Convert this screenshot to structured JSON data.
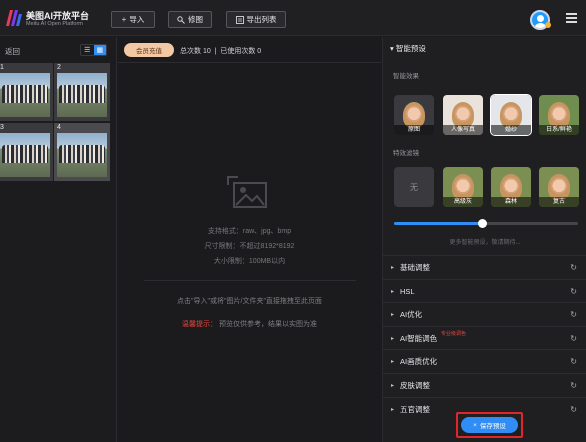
{
  "app": {
    "title": "美图AI开放平台",
    "subtitle": "Meitu AI Open Platform"
  },
  "toolbar": {
    "import_label": "导入",
    "retouch_label": "修图",
    "export_list_label": "导出列表"
  },
  "left_panel": {
    "back_label": "返回",
    "thumbnails": [
      {
        "number": "1"
      },
      {
        "number": "2"
      },
      {
        "number": "3"
      },
      {
        "number": "4"
      }
    ]
  },
  "center": {
    "vip_button": "会员充值",
    "total_count": "总次数 10",
    "separator": "|",
    "used_count": "已使用次数 0",
    "formats": "支持格式：raw、jpg、bmp",
    "size_limit": "尺寸限制：不超过8192*8192",
    "file_limit": "大小限制：100MB以内",
    "drop_hint": "点击\"导入\"或将\"图片/文件夹\"直接拖拽至此页面",
    "warm_tip_label": "温馨提示：",
    "warm_tip_text": "预览仅供参考，结果以实图为准"
  },
  "right_panel": {
    "section_title": "智能预设",
    "smart_effects_title": "智能效果",
    "smart_effects": [
      {
        "label": "原图"
      },
      {
        "label": "人像写真"
      },
      {
        "label": "婚纱"
      },
      {
        "label": "日系/鲜艳"
      }
    ],
    "filters_title": "特效滤镜",
    "filters": [
      {
        "label": "无"
      },
      {
        "label": "高级灰"
      },
      {
        "label": "森林"
      },
      {
        "label": "复古"
      }
    ],
    "slider_level": 0.48,
    "more_text": "更多智能预设，敬请期待...",
    "accordions": [
      {
        "label": "基础调整",
        "tag": ""
      },
      {
        "label": "HSL",
        "tag": ""
      },
      {
        "label": "AI优化",
        "tag": ""
      },
      {
        "label": "AI智能调色",
        "tag": "专业级调色"
      },
      {
        "label": "AI画质优化",
        "tag": ""
      },
      {
        "label": "皮肤调整",
        "tag": ""
      },
      {
        "label": "五官调整",
        "tag": ""
      }
    ],
    "save_preset_label": "保存预设"
  },
  "colors": {
    "accent": "#2f8df5",
    "warning": "#e2473e",
    "vip": "#f3c8a4"
  }
}
